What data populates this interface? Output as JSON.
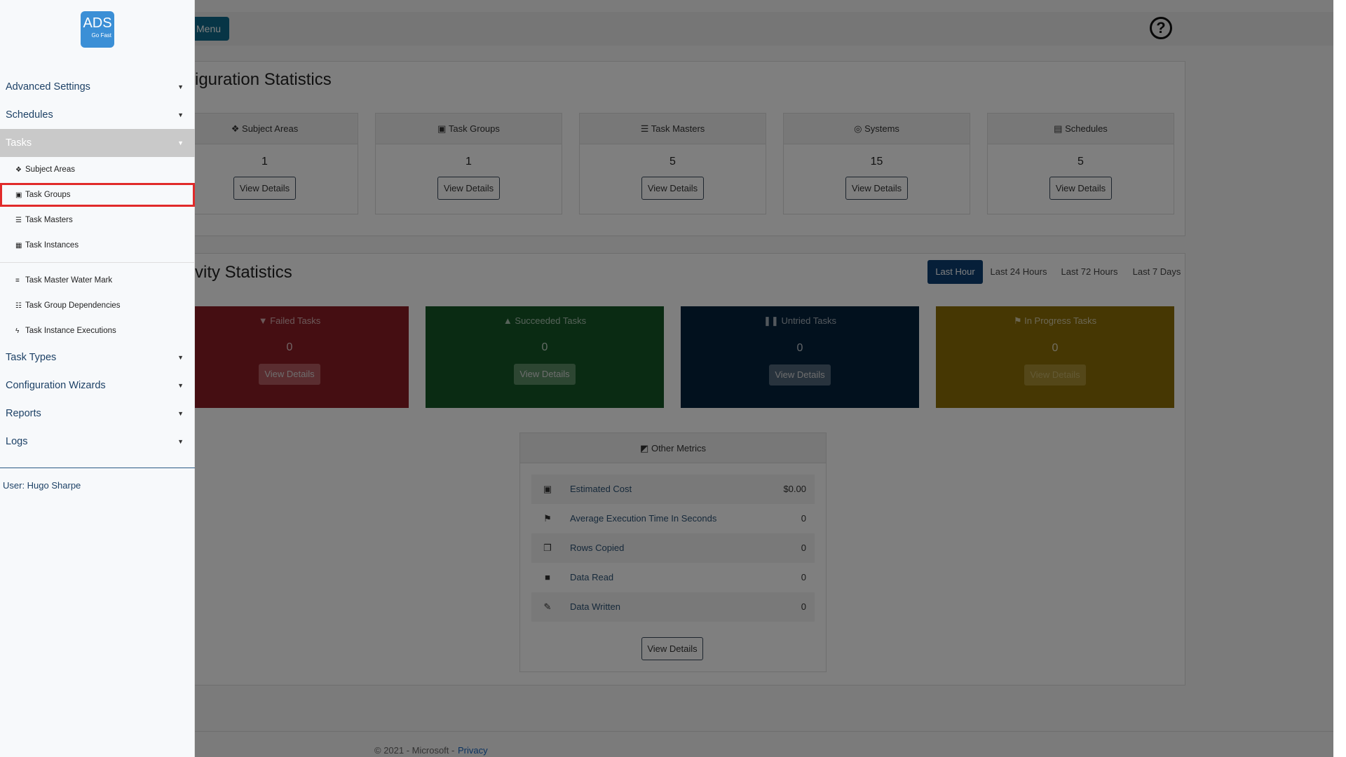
{
  "header": {
    "menu_label": "Menu"
  },
  "config_stats": {
    "title": "Configuration Statistics",
    "title_visible": "iguration Statistics",
    "cards": [
      {
        "label": "Subject Areas",
        "icon": "layers-icon",
        "glyph": "❖",
        "value": "1",
        "button": "View Details"
      },
      {
        "label": "Task Groups",
        "icon": "object-group-icon",
        "glyph": "▣",
        "value": "1",
        "button": "View Details"
      },
      {
        "label": "Task Masters",
        "icon": "list-icon",
        "glyph": "☰",
        "value": "5",
        "button": "View Details"
      },
      {
        "label": "Systems",
        "icon": "circle-dot-icon",
        "glyph": "◎",
        "value": "15",
        "button": "View Details"
      },
      {
        "label": "Schedules",
        "icon": "calendar-icon",
        "glyph": "▤",
        "value": "5",
        "button": "View Details"
      }
    ]
  },
  "activity_stats": {
    "title_visible": "vity Statistics",
    "ranges": [
      "Last Hour",
      "Last 24 Hours",
      "Last 72 Hours",
      "Last 7 Days"
    ],
    "active_range": "Last Hour",
    "tiles": [
      {
        "label": "Failed Tasks",
        "icon": "thumbs-down-icon",
        "glyph": "▼",
        "value": "0",
        "button": "View Details",
        "color": "#8a1d24"
      },
      {
        "label": "Succeeded Tasks",
        "icon": "thumbs-up-icon",
        "glyph": "▲",
        "value": "0",
        "button": "View Details",
        "color": "#155726"
      },
      {
        "label": "Untried Tasks",
        "icon": "pause-icon",
        "glyph": "❚❚",
        "value": "0",
        "button": "View Details",
        "color": "#04223d"
      },
      {
        "label": "In Progress Tasks",
        "icon": "running-icon",
        "glyph": "⚑",
        "value": "0",
        "button": "View Details",
        "color": "#8c6f06"
      }
    ]
  },
  "other_metrics": {
    "title": "Other Metrics",
    "rows": [
      {
        "label": "Estimated Cost",
        "icon": "money-icon",
        "glyph": "▣",
        "value": "$0.00"
      },
      {
        "label": "Average Execution Time In Seconds",
        "icon": "running-icon",
        "glyph": "⚑",
        "value": "0"
      },
      {
        "label": "Rows Copied",
        "icon": "copy-icon",
        "glyph": "❐",
        "value": "0"
      },
      {
        "label": "Data Read",
        "icon": "boxes-icon",
        "glyph": "■",
        "value": "0"
      },
      {
        "label": "Data Written",
        "icon": "pencil-icon",
        "glyph": "✎",
        "value": "0"
      }
    ],
    "button": "View Details"
  },
  "footer": {
    "copyright": "© 2021 - Microsoft -",
    "privacy": "Privacy"
  },
  "sidebar": {
    "logo": {
      "text": "ADS",
      "tagline": "Go Fast"
    },
    "sections": [
      {
        "label": "Advanced Settings"
      },
      {
        "label": "Schedules"
      },
      {
        "label": "Tasks"
      },
      {
        "label": "Task Types"
      },
      {
        "label": "Configuration Wizards"
      },
      {
        "label": "Reports"
      },
      {
        "label": "Logs"
      }
    ],
    "task_items": [
      {
        "label": "Subject Areas",
        "icon": "layers-icon",
        "glyph": "❖"
      },
      {
        "label": "Task Groups",
        "icon": "object-group-icon",
        "glyph": "▣"
      },
      {
        "label": "Task Masters",
        "icon": "list-icon",
        "glyph": "☰"
      },
      {
        "label": "Task Instances",
        "icon": "table-icon",
        "glyph": "▦"
      },
      {
        "label": "Task Master Water Mark",
        "icon": "bars-icon",
        "glyph": "≡"
      },
      {
        "label": "Task Group Dependencies",
        "icon": "list-alt-icon",
        "glyph": "☷"
      },
      {
        "label": "Task Instance Executions",
        "icon": "bolt-icon",
        "glyph": "ϟ"
      }
    ],
    "user": "User: Hugo Sharpe"
  },
  "colors": {
    "sidebar_active": "#c9c9c9",
    "highlight_border": "#e12a2a",
    "range_active": "#0d3e73",
    "nav_text": "#1d4166"
  }
}
